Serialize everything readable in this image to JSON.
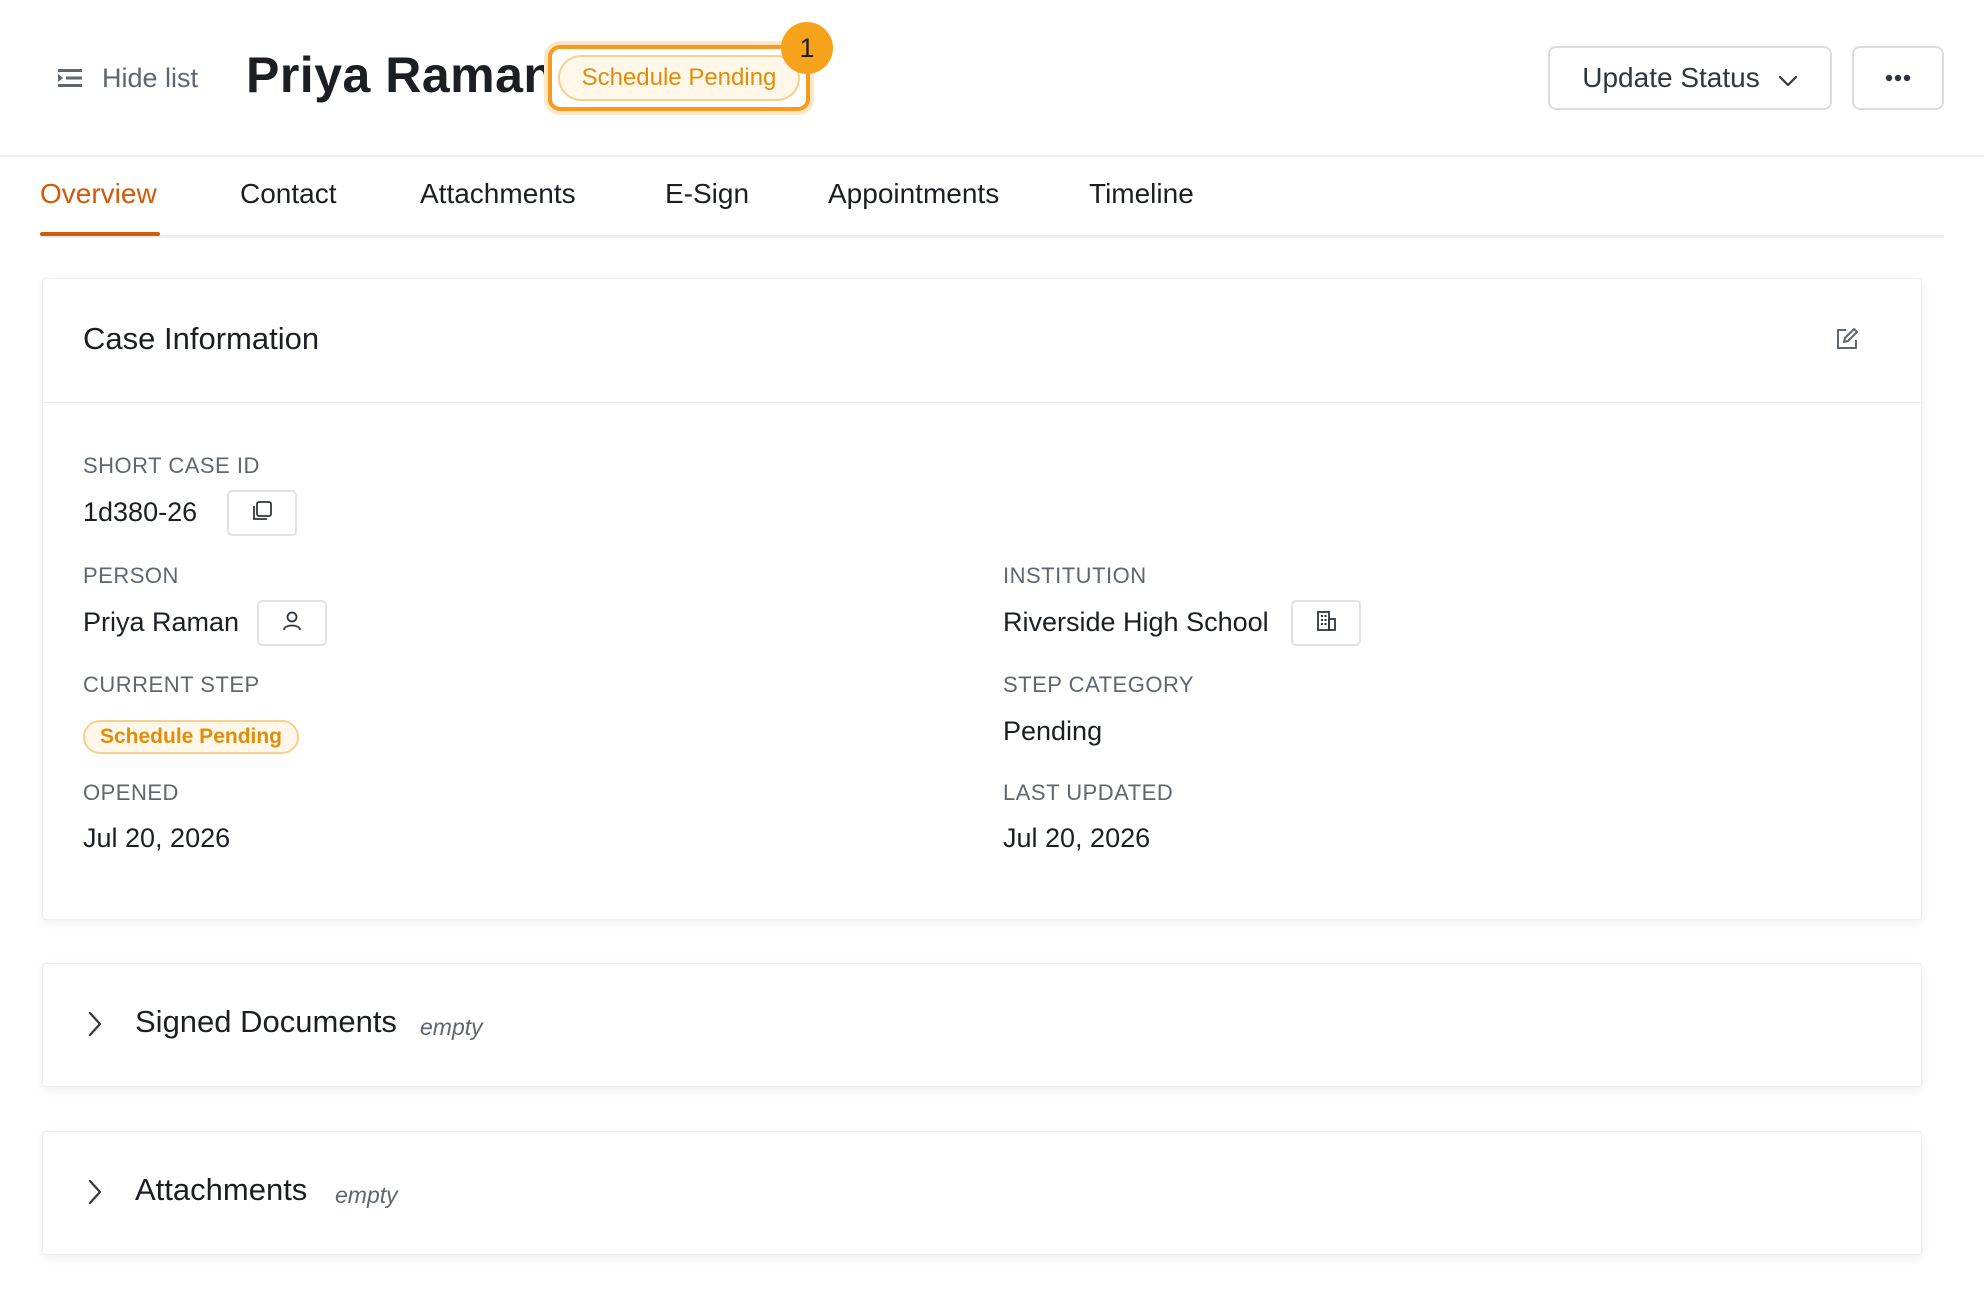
{
  "header": {
    "hide_list_label": "Hide list",
    "title": "Priya Raman",
    "status_badge": "Schedule Pending",
    "notification_count": "1",
    "update_status_label": "Update Status",
    "more_label": "..."
  },
  "tabs": [
    {
      "label": "Overview",
      "active": true
    },
    {
      "label": "Contact",
      "active": false
    },
    {
      "label": "Attachments",
      "active": false
    },
    {
      "label": "E-Sign",
      "active": false
    },
    {
      "label": "Appointments",
      "active": false
    },
    {
      "label": "Timeline",
      "active": false
    }
  ],
  "case_info": {
    "title": "Case Information",
    "short_case_id": {
      "label": "SHORT CASE ID",
      "value": "1d380-26"
    },
    "person": {
      "label": "PERSON",
      "value": "Priya Raman"
    },
    "institution": {
      "label": "INSTITUTION",
      "value": "Riverside High School"
    },
    "current_step": {
      "label": "CURRENT STEP",
      "value": "Schedule Pending"
    },
    "step_category": {
      "label": "STEP CATEGORY",
      "value": "Pending"
    },
    "opened": {
      "label": "OPENED",
      "value": "Jul 20, 2026"
    },
    "last_updated": {
      "label": "LAST UPDATED",
      "value": "Jul 20, 2026"
    }
  },
  "sections": [
    {
      "title": "Signed Documents",
      "state": "empty"
    },
    {
      "title": "Attachments",
      "state": "empty"
    }
  ],
  "colors": {
    "accent": "#d35a07",
    "status_orange": "#f79a1e",
    "status_text": "#e38c05",
    "status_bg": "#fff8ea"
  },
  "icons": {
    "hide_list": "list-collapse-icon",
    "dropdown": "chevron-down-icon",
    "more": "more-horizontal-icon",
    "edit": "edit-icon",
    "copy": "copy-icon",
    "person": "user-icon",
    "institution": "building-icon",
    "expand": "chevron-right-icon"
  }
}
